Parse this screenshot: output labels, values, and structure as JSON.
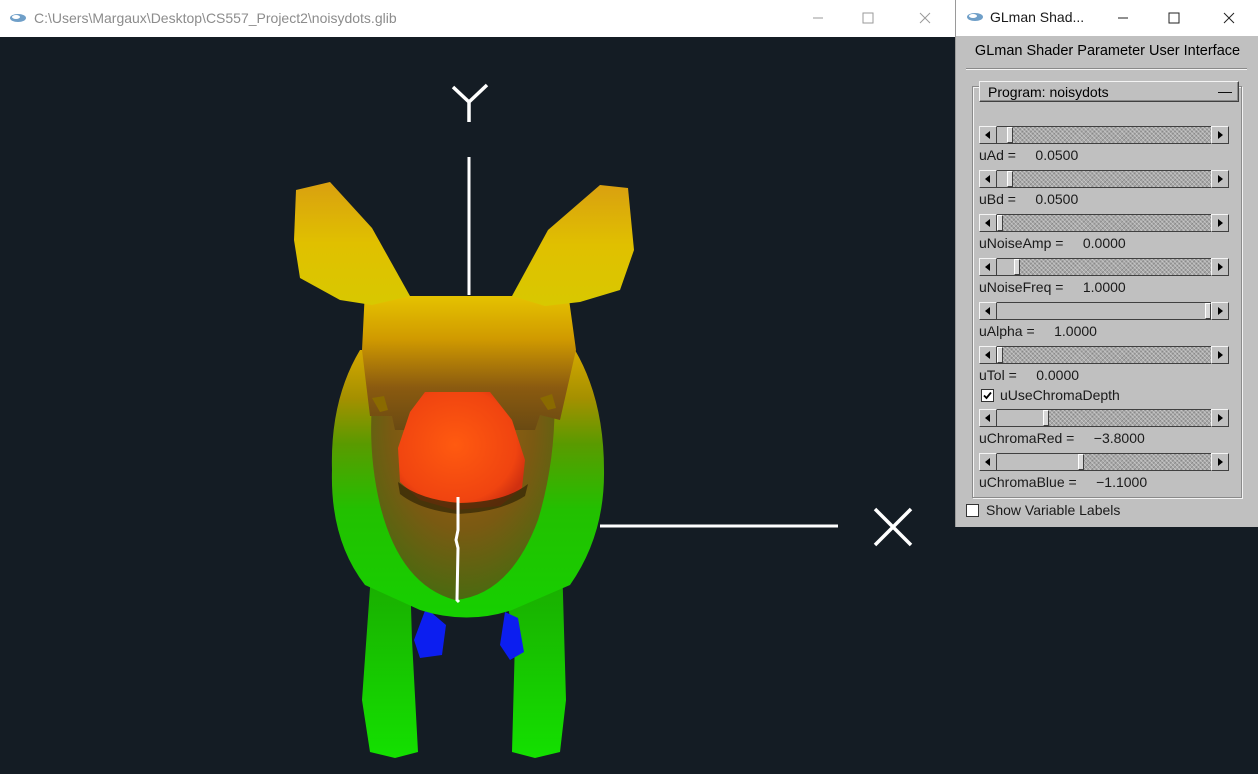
{
  "viewer": {
    "title": "C:\\Users\\Margaux\\Desktop\\CS557_Project2\\noisydots.glib",
    "axis_labels": {
      "y": "Y",
      "x": "X"
    }
  },
  "panel": {
    "title": "GLman Shad...",
    "heading": "GLman Shader Parameter User Interface",
    "program_label": "Program: noisydots",
    "collapse_symbol": "—",
    "params": [
      {
        "name": "uAd",
        "label": "uAd =     0.0500",
        "fraction": 0.05
      },
      {
        "name": "uBd",
        "label": "uBd =     0.0500",
        "fraction": 0.05
      },
      {
        "name": "uNoiseAmp",
        "label": "uNoiseAmp =     0.0000",
        "fraction": 0.0
      },
      {
        "name": "uNoiseFreq",
        "label": "uNoiseFreq =     1.0000",
        "fraction": 0.08
      },
      {
        "name": "uAlpha",
        "label": "uAlpha =     1.0000",
        "fraction": 1.0
      },
      {
        "name": "uTol",
        "label": "uTol =     0.0000",
        "fraction": 0.0
      }
    ],
    "chroma_checkbox": {
      "label": "uUseChromaDepth",
      "checked": true
    },
    "chroma_params": [
      {
        "name": "uChromaRed",
        "label": "uChromaRed =     −3.8000",
        "fraction": 0.22
      },
      {
        "name": "uChromaBlue",
        "label": "uChromaBlue =     −1.1000",
        "fraction": 0.39
      }
    ],
    "show_labels_checkbox": {
      "label": "Show Variable Labels",
      "checked": false
    }
  }
}
